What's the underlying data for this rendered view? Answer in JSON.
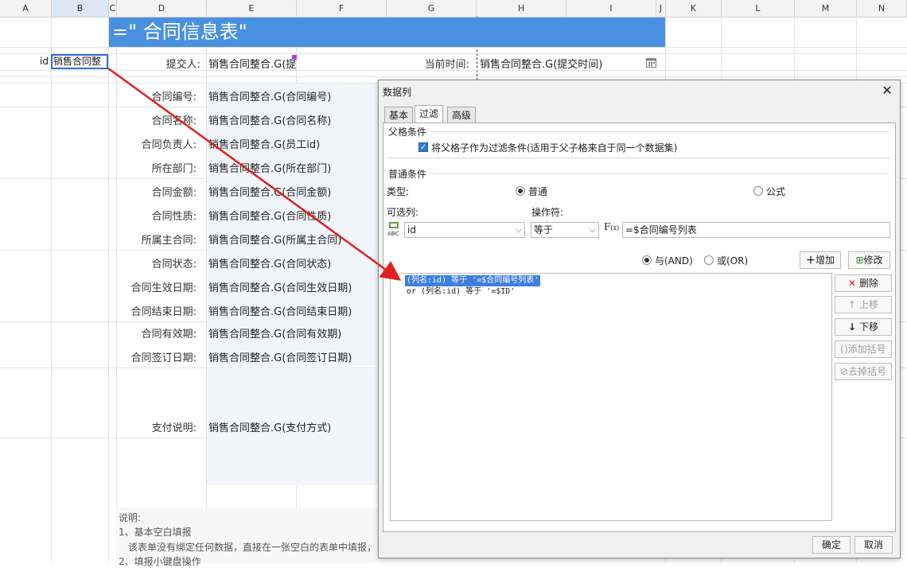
{
  "columns": [
    "A",
    "B",
    "C",
    "D",
    "E",
    "F",
    "G",
    "H",
    "I",
    "J",
    "K",
    "L",
    "M",
    "N"
  ],
  "title_text": "=\"  合同信息表\"",
  "cell_b": {
    "prefix": "id",
    "value": "销售合同整"
  },
  "submitter": {
    "label": "提交人:",
    "value": "销售合同整合.G(提"
  },
  "current_time": {
    "label": "当前时间:",
    "value": "销售合同整合.G(提交时间)"
  },
  "form_rows": [
    {
      "label": "合同编号:",
      "value": "销售合同整合.G(合同编号)"
    },
    {
      "label": "合同名称:",
      "value": "销售合同整合.G(合同名称)"
    },
    {
      "label": "合同负责人:",
      "value": "销售合同整合.G(员工id)"
    },
    {
      "label": "所在部门:",
      "value": "销售合同整合.G(所在部门)"
    },
    {
      "label": "合同金额:",
      "value": "销售合同整合.G(合同金额)"
    },
    {
      "label": "合同性质:",
      "value": "销售合同整合.G(合同性质)"
    },
    {
      "label": "所属主合同:",
      "value": "销售合同整合.G(所属主合同)"
    },
    {
      "label": "合同状态:",
      "value": "销售合同整合.G(合同状态)"
    },
    {
      "label": "合同生效日期:",
      "value": "销售合同整合.G(合同生效日期)"
    },
    {
      "label": "合同结束日期:",
      "value": "销售合同整合.G(合同结束日期)"
    },
    {
      "label": "合同有效期:",
      "value": "销售合同整合.G(合同有效期)"
    },
    {
      "label": "合同签订日期:",
      "value": "销售合同整合.G(合同签订日期)"
    }
  ],
  "payment": {
    "label": "支付说明:",
    "value": "销售合同整合.G(支付方式)"
  },
  "notes": {
    "title": "说明:",
    "line1": "1、基本空白填报",
    "line2": "该表单没有绑定任何数据，直接在一张空白的表单中填报，",
    "line3": "2、填报小键盘操作"
  },
  "dialog": {
    "title": "数据列",
    "tabs": [
      "基本",
      "过滤",
      "高级"
    ],
    "active_tab": "过滤",
    "parent_section": "父格条件",
    "parent_checkbox": "将父格子作为过滤条件(适用于父子格来自于同一个数据集)",
    "normal_section": "普通条件",
    "type_label": "类型:",
    "type_normal": "普通",
    "type_formula": "公式",
    "available_label": "可选列:",
    "operator_label": "操作符:",
    "column_value": "id",
    "operator_value": "等于",
    "formula_value": "=$合同编号列表",
    "and_label": "与(AND)",
    "or_label": "或(OR)",
    "add_btn": "增加",
    "modify_btn": "修改",
    "conditions": [
      "(列名:id) 等于 '=$合同编号列表'",
      "or  (列名:id) 等于 '=$ID'"
    ],
    "side_buttons": {
      "delete": "删除",
      "up": "上移",
      "down": "下移",
      "add_bracket": "添加括号",
      "remove_bracket": "去掉括号"
    },
    "ok": "确定",
    "cancel": "取消"
  },
  "colors": {
    "title_bar": "#4a90e0",
    "selection": "#3d7fe0",
    "arrow": "#e02020"
  }
}
